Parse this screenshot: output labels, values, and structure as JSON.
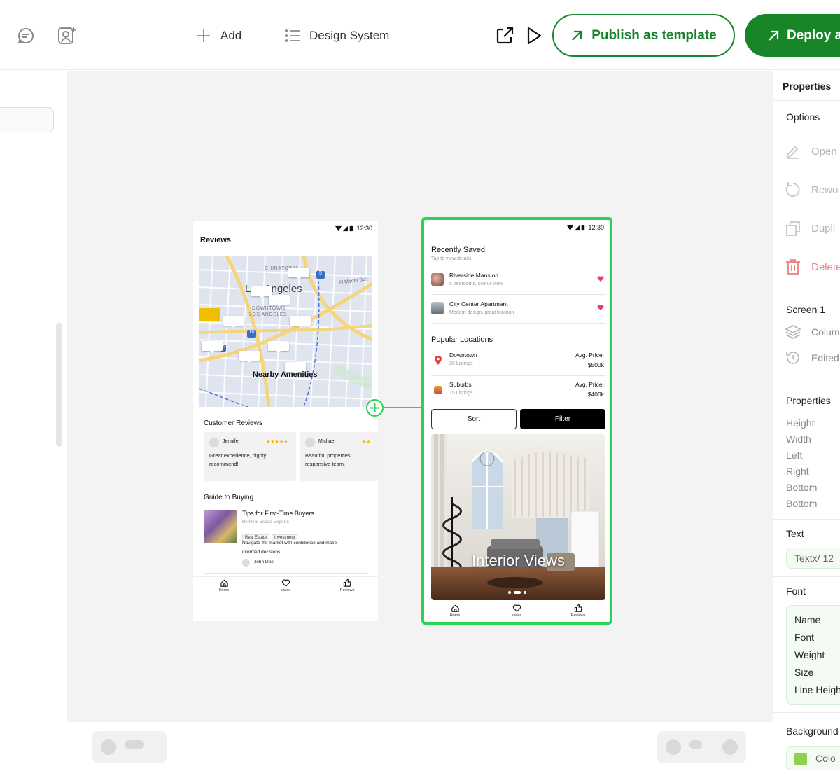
{
  "toolbar": {
    "add_label": "Add",
    "design_system_label": "Design System",
    "publish_label": "Publish as template",
    "deploy_label": "Deploy a",
    "accent": "#178528"
  },
  "icons": [
    "comment-icon",
    "add-user-icon",
    "plus-icon",
    "list-icon",
    "external-link-icon",
    "play-icon",
    "arrow-up-right-icon"
  ],
  "phone1": {
    "time": "12:30",
    "title": "Reviews",
    "map": {
      "chinatown": "CHINATOWN",
      "city": "Los Angeles",
      "downtown1": "DOWNTOWN",
      "downtown2": "LOS ANGELES",
      "road": "El Monte Bus",
      "shield1": "5",
      "shield2": "10",
      "shield3": "5",
      "overlay": "Nearby Amenities"
    },
    "reviews_title": "Customer Reviews",
    "reviews": [
      {
        "name": "Jennifer",
        "stars": "★★★★★",
        "text1": "Great experience, highly",
        "text2": "recommend!"
      },
      {
        "name": "Michael",
        "stars": "★★",
        "text1": "Beautiful properties,",
        "text2": "responsive team."
      }
    ],
    "guide_title": "Guide to Buying",
    "article": {
      "title": "Tips for First-Time Buyers",
      "by": "By Real Estate Experts",
      "tags": [
        "Real Estate",
        "Investment"
      ],
      "desc1": "Navigate the market with confidence and make",
      "desc2": "informed decisions.",
      "author": "John Doe"
    },
    "nav": [
      "Home",
      "saves",
      "Reviews"
    ]
  },
  "phone2": {
    "time": "12:30",
    "recent_title": "Recently Saved",
    "recent_sub": "Tap to view details",
    "saved": [
      {
        "name": "Riverside Mansion",
        "desc": "5 bedrooms, scenic view"
      },
      {
        "name": "City Center Apartment",
        "desc": "Modern design, great location"
      }
    ],
    "popular_title": "Popular Locations",
    "locations": [
      {
        "name": "Downtown",
        "count": "20 Listings",
        "price_label": "Avg. Price:",
        "price": "$500k"
      },
      {
        "name": "Suburbs",
        "count": "15 Listings",
        "price_label": "Avg. Price:",
        "price": "$400k"
      }
    ],
    "sort_label": "Sort",
    "filter_label": "Filter",
    "hero_caption": "Interior Views",
    "nav": [
      "Home",
      "saves",
      "Reviews"
    ],
    "selection_color": "#2ed158"
  },
  "props": {
    "title": "Properties",
    "options_title": "Options",
    "options": [
      {
        "label": "Open",
        "icon": "pencil-icon",
        "color": "#b5b5b5"
      },
      {
        "label": "Rewo",
        "icon": "refresh-icon",
        "color": "#b5b5b5"
      },
      {
        "label": "Dupli",
        "icon": "copy-icon",
        "color": "#b5b5b5"
      },
      {
        "label": "Delete",
        "icon": "trash-icon",
        "color": "#f08080"
      }
    ],
    "screen_title": "Screen 1",
    "screen_items": [
      {
        "label": "Colum",
        "icon": "layers-icon"
      },
      {
        "label": "Edited",
        "icon": "history-icon"
      }
    ],
    "properties_title": "Properties",
    "property_keys": [
      "Height",
      "Width",
      "Left",
      "Right",
      "Bottom",
      "Bottom"
    ],
    "text_title": "Text",
    "text_value": "Textx/ 12",
    "font_title": "Font",
    "font_keys": [
      "Name",
      "Font",
      "Weight",
      "Size",
      "Line Heigh"
    ],
    "background_title": "Background",
    "background_value": "Colo",
    "background_swatch": "#8fd14f"
  }
}
